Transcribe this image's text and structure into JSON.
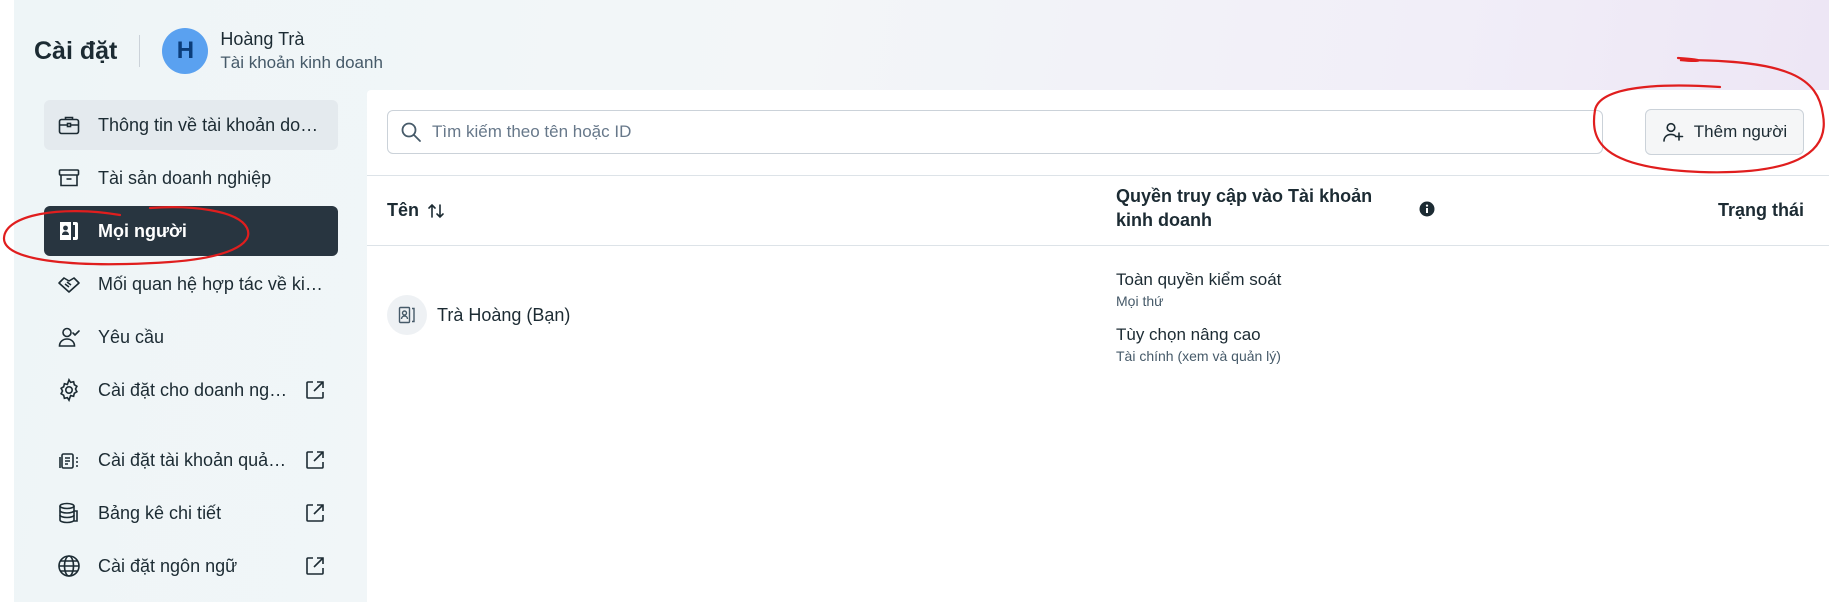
{
  "header": {
    "title": "Cài đặt",
    "avatar_letter": "H",
    "account_name": "Hoàng Trà",
    "account_type": "Tài khoản kinh doanh"
  },
  "sidebar": {
    "items": [
      {
        "label": "Thông tin về tài khoản doanh nghiệp",
        "icon": "briefcase-icon",
        "state": "hover",
        "external": false
      },
      {
        "label": "Tài sản doanh nghiệp",
        "icon": "archive-box-icon",
        "state": "normal",
        "external": false
      },
      {
        "label": "Mọi người",
        "icon": "people-badge-icon",
        "state": "active",
        "external": false
      },
      {
        "label": "Mối quan hệ hợp tác về kinh doanh",
        "icon": "handshake-icon",
        "state": "normal",
        "external": false
      },
      {
        "label": "Yêu cầu",
        "icon": "person-check-icon",
        "state": "normal",
        "external": false
      },
      {
        "label": "Cài đặt cho doanh nghiệp",
        "icon": "gear-icon",
        "state": "normal",
        "external": true
      },
      {
        "label": "Cài đặt tài khoản quảng cáo",
        "icon": "ad-account-icon",
        "state": "normal",
        "external": true
      },
      {
        "label": "Bảng kê chi tiết",
        "icon": "coins-stack-icon",
        "state": "normal",
        "external": true
      },
      {
        "label": "Cài đặt ngôn ngữ",
        "icon": "globe-icon",
        "state": "normal",
        "external": true
      }
    ]
  },
  "main": {
    "search_placeholder": "Tìm kiếm theo tên hoặc ID",
    "add_button": "Thêm người",
    "columns": {
      "name": "Tên",
      "access": "Quyền truy cập vào Tài khoản kinh doanh",
      "status": "Trạng thái"
    },
    "rows": [
      {
        "name": "Trà Hoàng (Bạn)",
        "permissions": [
          {
            "title": "Toàn quyền kiểm soát",
            "detail": "Mọi thứ"
          },
          {
            "title": "Tùy chọn nâng cao",
            "detail": "Tài chính (xem và quản lý)"
          }
        ],
        "status": ""
      }
    ]
  },
  "colors": {
    "active_nav_bg": "#283540",
    "avatar_bg": "#5aa1f0",
    "annotation_red": "#e01e1e"
  }
}
